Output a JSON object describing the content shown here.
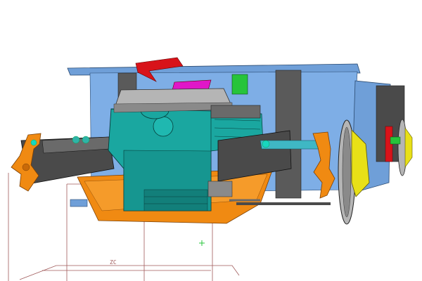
{
  "viewport": {
    "background": "#ffffff",
    "triad_label": "ZC"
  },
  "colors": {
    "frame_blue": "#6f9fd8",
    "frame_dark": "#4f7fb8",
    "engine_teal": "#1aa7a0",
    "engine_dark": "#0c6e6a",
    "cover_grey": "#a7a7a7",
    "orange": "#f08a12",
    "dark_grey": "#4a4a4a",
    "mid_grey": "#6a6a6a",
    "yellow": "#e8e017",
    "red": "#d8131a",
    "magenta": "#e017c8",
    "green": "#27c43b",
    "link_cyan": "#3fb7c4",
    "sketch_line": "#a05a5a"
  },
  "icons": {
    "origin_marker": "crosshair-icon"
  }
}
